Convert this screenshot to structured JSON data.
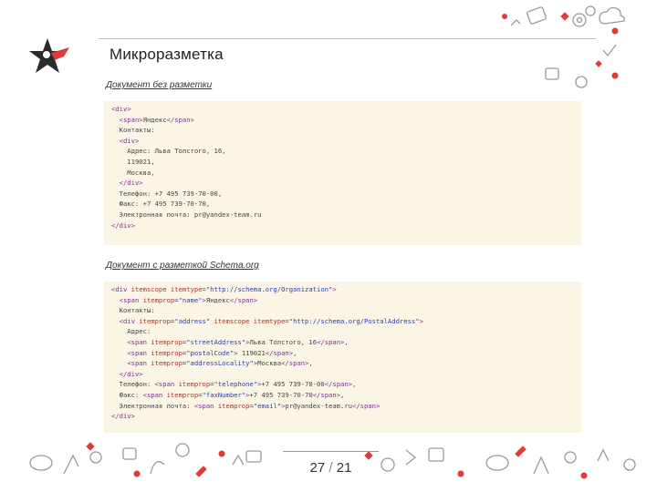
{
  "header": {
    "title": "Микроразметка"
  },
  "section1": {
    "label": "Документ без разметки",
    "lines": [
      [
        {
          "t": "<div>",
          "c": "tag"
        }
      ],
      [
        {
          "t": "  "
        },
        {
          "t": "<span>",
          "c": "tag"
        },
        {
          "t": "Яндекс"
        },
        {
          "t": "</span>",
          "c": "tag"
        }
      ],
      [
        {
          "t": "  Контакты:"
        }
      ],
      [
        {
          "t": "  "
        },
        {
          "t": "<div>",
          "c": "tag"
        }
      ],
      [
        {
          "t": "    Адрес: Льва Толстого, 16,"
        }
      ],
      [
        {
          "t": "    119021,"
        }
      ],
      [
        {
          "t": "    Москва,"
        }
      ],
      [
        {
          "t": "  "
        },
        {
          "t": "</div>",
          "c": "tag"
        }
      ],
      [
        {
          "t": "  Телефон: +7 495 739-70-00,"
        }
      ],
      [
        {
          "t": "  Факс: +7 495 739-70-70,"
        }
      ],
      [
        {
          "t": "  Электронная почта: pr@yandex-team.ru"
        }
      ],
      [
        {
          "t": "</div>",
          "c": "tag"
        }
      ]
    ]
  },
  "section2": {
    "label": "Документ с разметкой Schema.org",
    "lines": [
      [
        {
          "t": "<div ",
          "c": "tag"
        },
        {
          "t": "itemscope itemtype",
          "c": "attr"
        },
        {
          "t": "="
        },
        {
          "t": "\"http://schema.org/Organization\"",
          "c": "val"
        },
        {
          "t": ">",
          "c": "tag"
        }
      ],
      [
        {
          "t": "  "
        },
        {
          "t": "<span ",
          "c": "tag"
        },
        {
          "t": "itemprop",
          "c": "attr"
        },
        {
          "t": "="
        },
        {
          "t": "\"name\"",
          "c": "val"
        },
        {
          "t": ">",
          "c": "tag"
        },
        {
          "t": "Яндекс"
        },
        {
          "t": "</span>",
          "c": "tag"
        }
      ],
      [
        {
          "t": "  Контакты:"
        }
      ],
      [
        {
          "t": "  "
        },
        {
          "t": "<div ",
          "c": "tag"
        },
        {
          "t": "itemprop",
          "c": "attr"
        },
        {
          "t": "="
        },
        {
          "t": "\"address\"",
          "c": "val"
        },
        {
          "t": " "
        },
        {
          "t": "itemscope itemtype",
          "c": "attr"
        },
        {
          "t": "="
        },
        {
          "t": "\"http://schema.org/PostalAddress\"",
          "c": "val"
        },
        {
          "t": ">",
          "c": "tag"
        }
      ],
      [
        {
          "t": "    Адрес:"
        }
      ],
      [
        {
          "t": "    "
        },
        {
          "t": "<span ",
          "c": "tag"
        },
        {
          "t": "itemprop",
          "c": "attr"
        },
        {
          "t": "="
        },
        {
          "t": "\"streetAddress\"",
          "c": "val"
        },
        {
          "t": ">",
          "c": "tag"
        },
        {
          "t": "Льва Толстого, 16"
        },
        {
          "t": "</span>",
          "c": "tag"
        },
        {
          "t": ","
        }
      ],
      [
        {
          "t": "    "
        },
        {
          "t": "<span ",
          "c": "tag"
        },
        {
          "t": "itemprop",
          "c": "attr"
        },
        {
          "t": "="
        },
        {
          "t": "\"postalCode\"",
          "c": "val"
        },
        {
          "t": ">",
          "c": "tag"
        },
        {
          "t": " 119021"
        },
        {
          "t": "</span>",
          "c": "tag"
        },
        {
          "t": ","
        }
      ],
      [
        {
          "t": "    "
        },
        {
          "t": "<span ",
          "c": "tag"
        },
        {
          "t": "itemprop",
          "c": "attr"
        },
        {
          "t": "="
        },
        {
          "t": "\"addressLocality\"",
          "c": "val"
        },
        {
          "t": ">",
          "c": "tag"
        },
        {
          "t": "Москва"
        },
        {
          "t": "</span>",
          "c": "tag"
        },
        {
          "t": ","
        }
      ],
      [
        {
          "t": "  "
        },
        {
          "t": "</div>",
          "c": "tag"
        }
      ],
      [
        {
          "t": "  Телефон: "
        },
        {
          "t": "<span ",
          "c": "tag"
        },
        {
          "t": "itemprop",
          "c": "attr"
        },
        {
          "t": "="
        },
        {
          "t": "\"telephone\"",
          "c": "val"
        },
        {
          "t": ">",
          "c": "tag"
        },
        {
          "t": "+7 495 739-70-00"
        },
        {
          "t": "</span>",
          "c": "tag"
        },
        {
          "t": ","
        }
      ],
      [
        {
          "t": "  Факс: "
        },
        {
          "t": "<span ",
          "c": "tag"
        },
        {
          "t": "itemprop",
          "c": "attr"
        },
        {
          "t": "="
        },
        {
          "t": "\"faxNumber\"",
          "c": "val"
        },
        {
          "t": ">",
          "c": "tag"
        },
        {
          "t": "+7 495 739-70-70"
        },
        {
          "t": "</span>",
          "c": "tag"
        },
        {
          "t": ","
        }
      ],
      [
        {
          "t": "  Электронная почта: "
        },
        {
          "t": "<span ",
          "c": "tag"
        },
        {
          "t": "itemprop",
          "c": "attr"
        },
        {
          "t": "="
        },
        {
          "t": "\"email\"",
          "c": "val"
        },
        {
          "t": ">",
          "c": "tag"
        },
        {
          "t": "pr@yandex-team.ru"
        },
        {
          "t": "</span>",
          "c": "tag"
        }
      ],
      [
        {
          "t": "</div>",
          "c": "tag"
        }
      ]
    ]
  },
  "footer": {
    "current": "27",
    "separator": "/",
    "total": "21"
  },
  "colors": {
    "accent": "#e03a3a",
    "code_bg": "#fbf5e6",
    "tag": "#7b2f8f",
    "attr": "#a6362b",
    "value": "#2d3fa8"
  }
}
